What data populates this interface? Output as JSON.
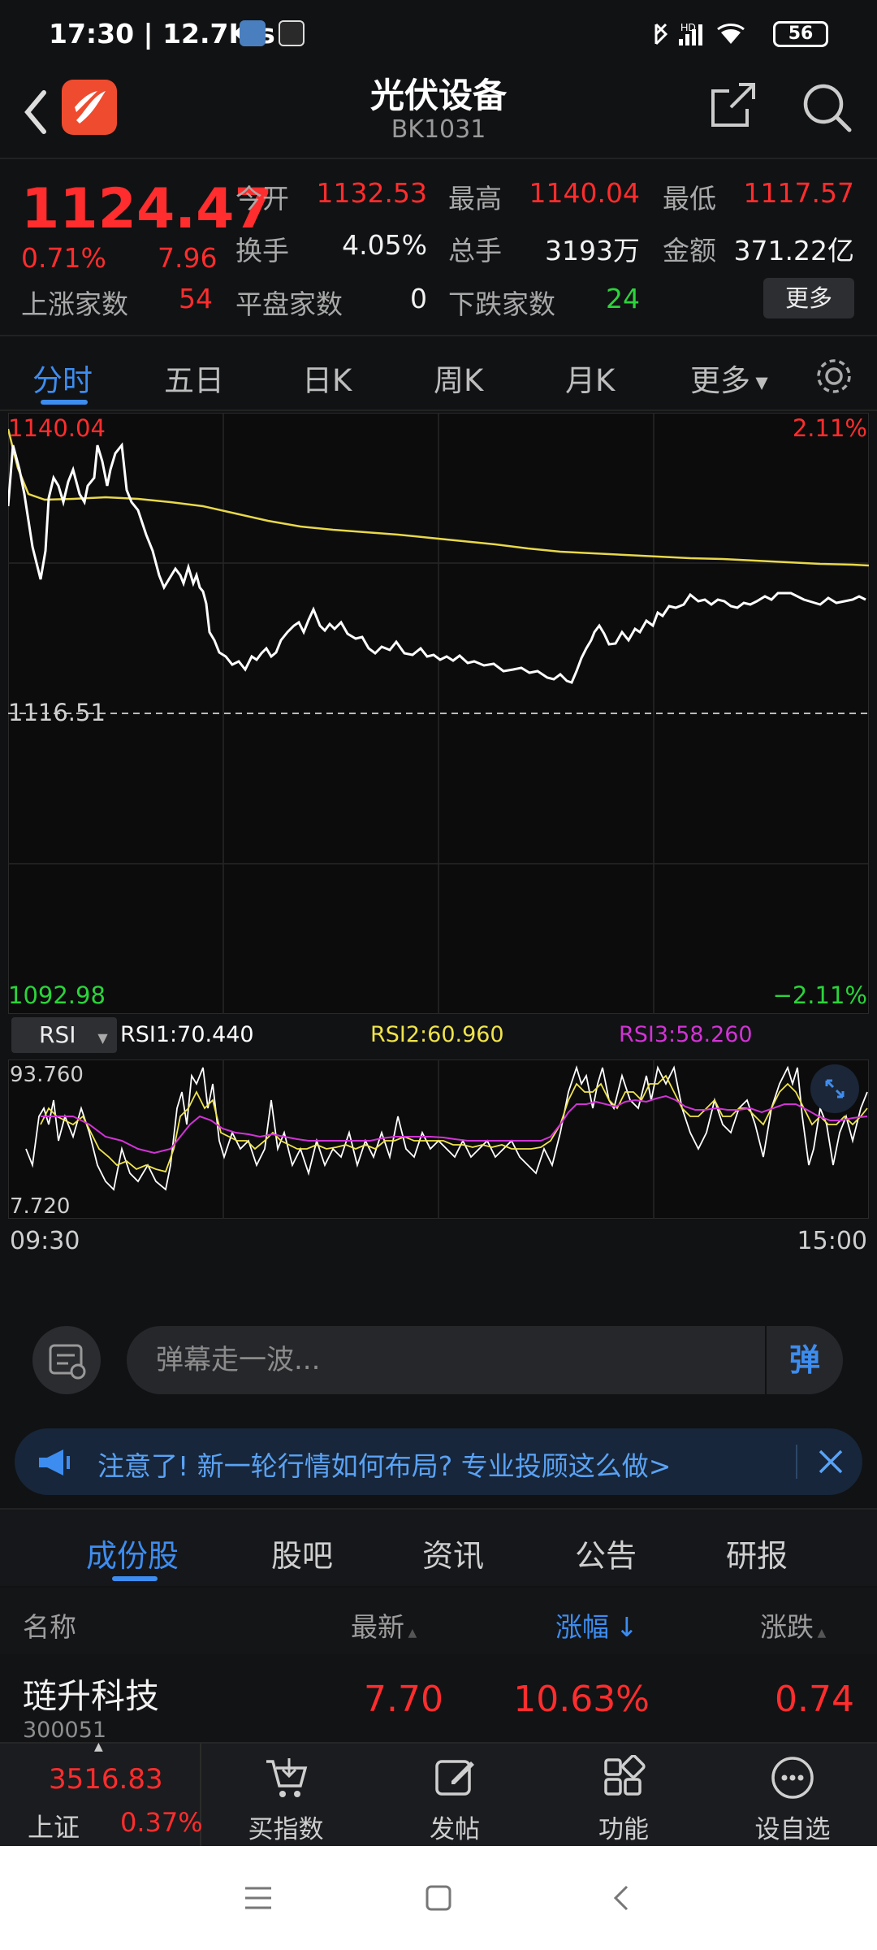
{
  "status_bar": {
    "time": "17:30 | 12.7K/s",
    "battery": "56",
    "signal": "HD"
  },
  "header": {
    "title": "光伏设备",
    "code": "BK1031"
  },
  "quote": {
    "price": "1124.47",
    "change_pct": "0.71%",
    "change": "7.96",
    "open_label": "今开",
    "open": "1132.53",
    "high_label": "最高",
    "high": "1140.04",
    "low_label": "最低",
    "low": "1117.57",
    "turnover_label": "换手",
    "turnover": "4.05%",
    "volume_label": "总手",
    "volume": "3193万",
    "amount_label": "金额",
    "amount": "371.22亿",
    "up_label": "上涨家数",
    "up": "54",
    "flat_label": "平盘家数",
    "flat": "0",
    "down_label": "下跌家数",
    "down": "24",
    "more_button": "更多"
  },
  "tabs": [
    "分时",
    "五日",
    "日K",
    "周K",
    "月K",
    "更多"
  ],
  "chart": {
    "top_price": "1140.04",
    "top_pct": "2.11%",
    "mid_price": "1116.51",
    "bottom_price": "1092.98",
    "bottom_pct": "−2.11%",
    "start_time": "09:30",
    "end_time": "15:00"
  },
  "rsi": {
    "selector": "RSI",
    "rsi1": "RSI1:70.440",
    "rsi2": "RSI2:60.960",
    "rsi3": "RSI3:58.260",
    "max": "93.760",
    "min": "7.720"
  },
  "danmu": {
    "placeholder": "弹幕走一波...",
    "button": "弹"
  },
  "notice": {
    "text": "注意了! 新一轮行情如何布局? 专业投顾这么做>"
  },
  "section_tabs": [
    "成份股",
    "股吧",
    "资讯",
    "公告",
    "研报"
  ],
  "columns": {
    "name": "名称",
    "latest": "最新",
    "change_pct": "涨幅",
    "change": "涨跌"
  },
  "rows": [
    {
      "name": "琏升科技",
      "code": "300051",
      "latest": "7.70",
      "change_pct": "10.63%",
      "change": "0.74"
    }
  ],
  "bottom_bar": {
    "index_value": "3516.83",
    "index_name": "上证",
    "index_pct": "0.37%",
    "items": [
      "买指数",
      "发帖",
      "功能",
      "设自选"
    ]
  },
  "colors": {
    "up": "#ff2d2d",
    "down": "#2bd43a",
    "accent": "#3d8df0",
    "price_line": "#ffffff",
    "avg_line": "#e8d84a",
    "rsi1": "#ffffff",
    "rsi2": "#f0e44a",
    "rsi3": "#d233d6"
  }
}
